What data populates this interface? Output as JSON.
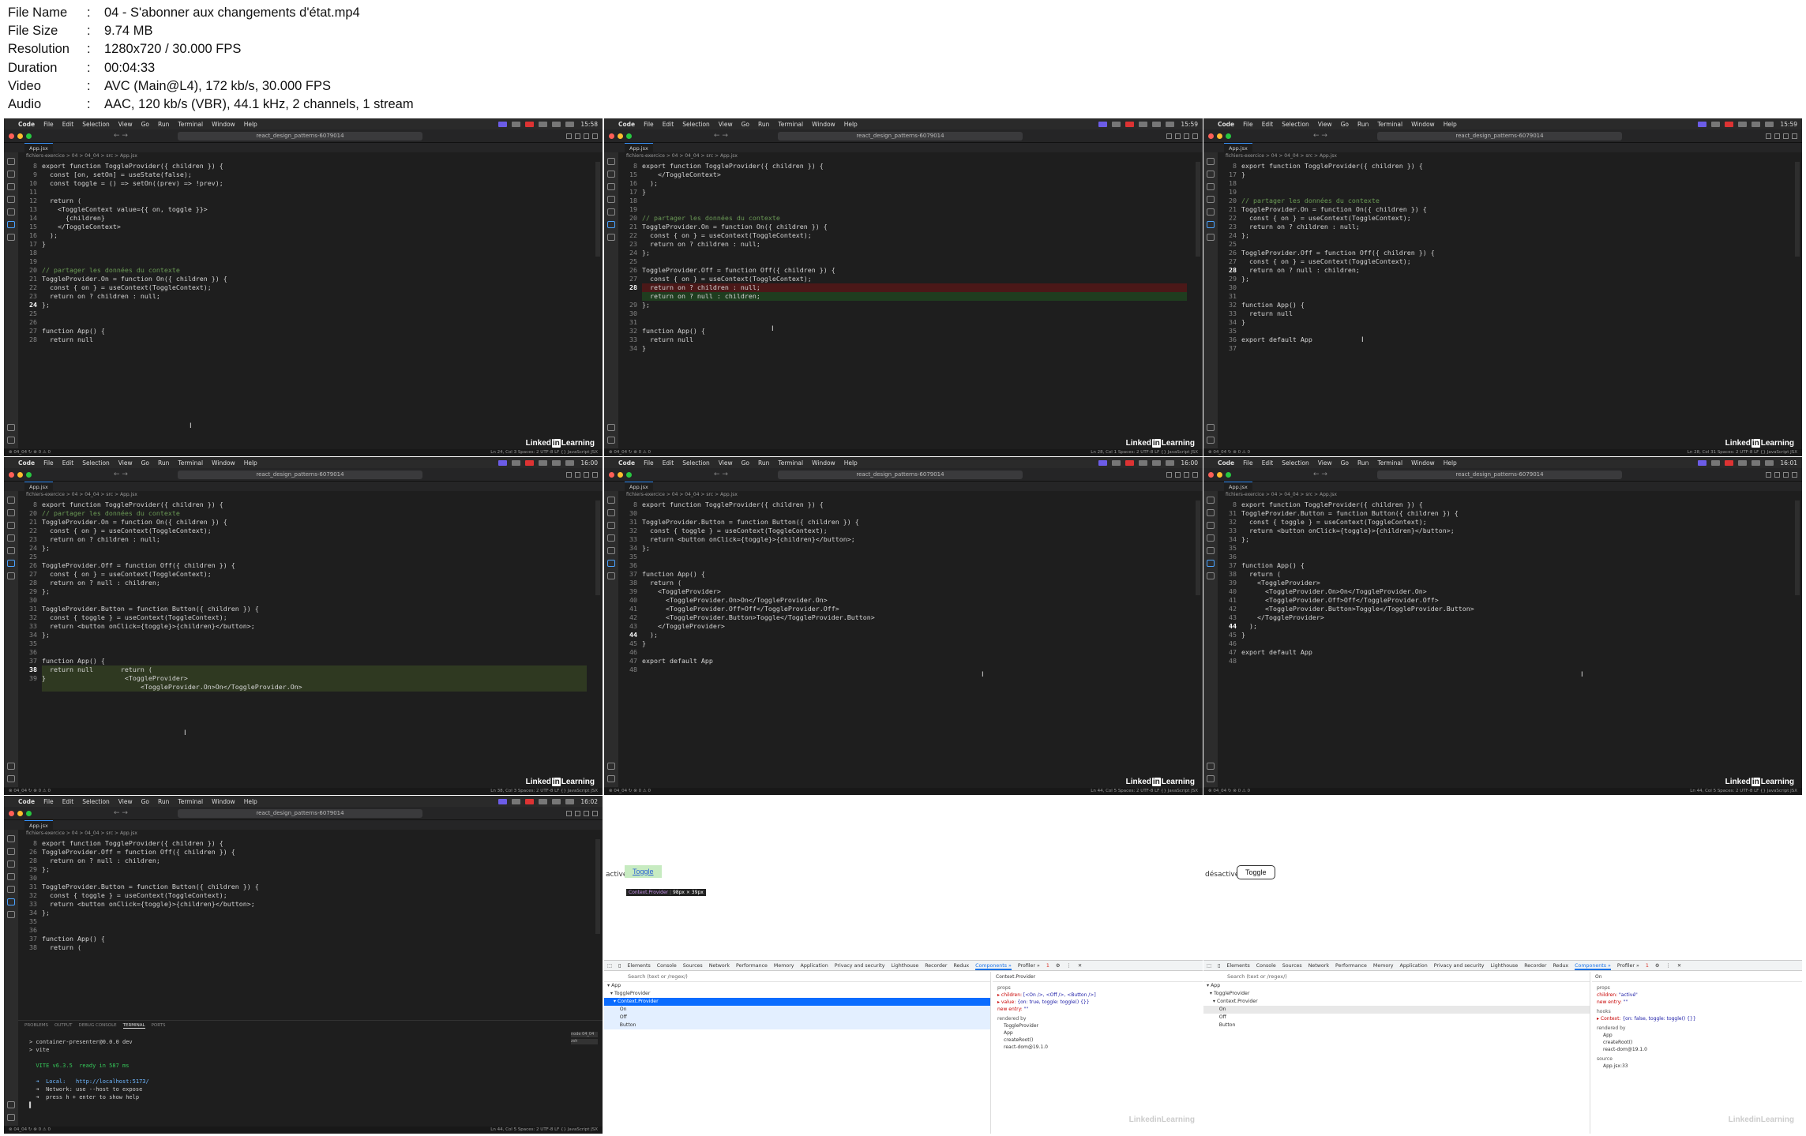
{
  "info": {
    "rows": [
      {
        "k": "File Name",
        "v": "04 - S'abonner aux changements d'état.mp4"
      },
      {
        "k": "File Size",
        "v": "9.74 MB"
      },
      {
        "k": "Resolution",
        "v": "1280x720 / 30.000 FPS"
      },
      {
        "k": "Duration",
        "v": "00:04:33"
      },
      {
        "k": "Video",
        "v": "AVC (Main@L4), 172 kb/s, 30.000 FPS"
      },
      {
        "k": "Audio",
        "v": "AAC, 120 kb/s (VBR), 44.1 kHz, 2 channels, 1 stream"
      }
    ]
  },
  "common": {
    "menu": [
      "Code",
      "File",
      "Edit",
      "Selection",
      "View",
      "Go",
      "Run",
      "Terminal",
      "Window",
      "Help"
    ],
    "search": "react_design_patterns-6079014",
    "tab": "App.jsx",
    "crumb": "fichiers-exercice > 04 > 04_04 > src > App.jsx",
    "branding_a": "Linked",
    "branding_b": "in",
    "branding_c": "Learning"
  },
  "editors": [
    {
      "clock": "15:58",
      "lines": [
        {
          "n": "8",
          "t": "export function ToggleProvider({ children }) {"
        },
        {
          "n": "9",
          "t": "  const [on, setOn] = useState(false);"
        },
        {
          "n": "10",
          "t": "  const toggle = () => setOn((prev) => !prev);"
        },
        {
          "n": "11",
          "t": ""
        },
        {
          "n": "12",
          "t": "  return ("
        },
        {
          "n": "13",
          "t": "    <ToggleContext value={{ on, toggle }}>"
        },
        {
          "n": "14",
          "t": "      {children}"
        },
        {
          "n": "15",
          "t": "    </ToggleContext>"
        },
        {
          "n": "16",
          "t": "  );"
        },
        {
          "n": "17",
          "t": "}"
        },
        {
          "n": "18",
          "t": ""
        },
        {
          "n": "19",
          "t": ""
        },
        {
          "n": "20",
          "t": "// partager les données du contexte"
        },
        {
          "n": "21",
          "t": "ToggleProvider.On = function On({ children }) {"
        },
        {
          "n": "22",
          "t": "  const { on } = useContext(ToggleContext);"
        },
        {
          "n": "23",
          "t": "  return on ? children : null;"
        },
        {
          "n": "24",
          "t": "};"
        },
        {
          "n": "25",
          "t": ""
        },
        {
          "n": "26",
          "t": ""
        },
        {
          "n": "27",
          "t": "function App() {"
        },
        {
          "n": "28",
          "t": "  return null"
        }
      ],
      "cur": "24",
      "status_left": "⊗ 04_04 ↻ ⊗ 0 ⚠ 0",
      "status_right": "Ln 24, Col 3   Spaces: 2   UTF-8   LF   {} JavaScript JSX"
    },
    {
      "clock": "15:59",
      "lines": [
        {
          "n": "8",
          "t": "export function ToggleProvider({ children }) {"
        },
        {
          "n": "15",
          "t": "    </ToggleContext>"
        },
        {
          "n": "16",
          "t": "  );"
        },
        {
          "n": "17",
          "t": "}"
        },
        {
          "n": "18",
          "t": ""
        },
        {
          "n": "19",
          "t": ""
        },
        {
          "n": "20",
          "t": "// partager les données du contexte"
        },
        {
          "n": "21",
          "t": "ToggleProvider.On = function On({ children }) {"
        },
        {
          "n": "22",
          "t": "  const { on } = useContext(ToggleContext);"
        },
        {
          "n": "23",
          "t": "  return on ? children : null;"
        },
        {
          "n": "24",
          "t": "};"
        },
        {
          "n": "25",
          "t": ""
        },
        {
          "n": "26",
          "t": "ToggleProvider.Off = function Off({ children }) {"
        },
        {
          "n": "27",
          "t": "  const { on } = useContext(ToggleContext);"
        },
        {
          "n": "28",
          "t": "  return on ? children : null;"
        },
        {
          "n": "",
          "t": "  return on ? null : children;"
        },
        {
          "n": "29",
          "t": "};"
        },
        {
          "n": "30",
          "t": ""
        },
        {
          "n": "31",
          "t": ""
        },
        {
          "n": "32",
          "t": "function App() {"
        },
        {
          "n": "33",
          "t": "  return null"
        },
        {
          "n": "34",
          "t": "}"
        }
      ],
      "cur": "28",
      "status_left": "⊗ 04_04 ↻ ⊗ 0 ⚠ 0",
      "status_right": "Ln 28, Col 1   Spaces: 2   UTF-8   LF   {} JavaScript JSX"
    },
    {
      "clock": "15:59",
      "lines": [
        {
          "n": "8",
          "t": "export function ToggleProvider({ children }) {"
        },
        {
          "n": "17",
          "t": "}"
        },
        {
          "n": "18",
          "t": ""
        },
        {
          "n": "19",
          "t": ""
        },
        {
          "n": "20",
          "t": "// partager les données du contexte"
        },
        {
          "n": "21",
          "t": "ToggleProvider.On = function On({ children }) {"
        },
        {
          "n": "22",
          "t": "  const { on } = useContext(ToggleContext);"
        },
        {
          "n": "23",
          "t": "  return on ? children : null;"
        },
        {
          "n": "24",
          "t": "};"
        },
        {
          "n": "25",
          "t": ""
        },
        {
          "n": "26",
          "t": "ToggleProvider.Off = function Off({ children }) {"
        },
        {
          "n": "27",
          "t": "  const { on } = useContext(ToggleContext);"
        },
        {
          "n": "28",
          "t": "  return on ? null : children;"
        },
        {
          "n": "29",
          "t": "};"
        },
        {
          "n": "30",
          "t": ""
        },
        {
          "n": "31",
          "t": ""
        },
        {
          "n": "32",
          "t": "function App() {"
        },
        {
          "n": "33",
          "t": "  return null"
        },
        {
          "n": "34",
          "t": "}"
        },
        {
          "n": "35",
          "t": ""
        },
        {
          "n": "36",
          "t": "export default App"
        },
        {
          "n": "37",
          "t": ""
        }
      ],
      "cur": "28",
      "status_left": "⊗ 04_04 ↻ ⊗ 0 ⚠ 0",
      "status_right": "Ln 28, Col 31   Spaces: 2   UTF-8   LF   {} JavaScript JSX"
    },
    {
      "clock": "16:00",
      "lines": [
        {
          "n": "8",
          "t": "export function ToggleProvider({ children }) {"
        },
        {
          "n": "20",
          "t": "// partager les données du contexte"
        },
        {
          "n": "21",
          "t": "ToggleProvider.On = function On({ children }) {"
        },
        {
          "n": "22",
          "t": "  const { on } = useContext(ToggleContext);"
        },
        {
          "n": "23",
          "t": "  return on ? children : null;"
        },
        {
          "n": "24",
          "t": "};"
        },
        {
          "n": "25",
          "t": ""
        },
        {
          "n": "26",
          "t": "ToggleProvider.Off = function Off({ children }) {"
        },
        {
          "n": "27",
          "t": "  const { on } = useContext(ToggleContext);"
        },
        {
          "n": "28",
          "t": "  return on ? null : children;"
        },
        {
          "n": "29",
          "t": "};"
        },
        {
          "n": "30",
          "t": ""
        },
        {
          "n": "31",
          "t": "ToggleProvider.Button = function Button({ children }) {"
        },
        {
          "n": "32",
          "t": "  const { toggle } = useContext(ToggleContext);"
        },
        {
          "n": "33",
          "t": "  return <button onClick={toggle}>{children}</button>;"
        },
        {
          "n": "34",
          "t": "};"
        },
        {
          "n": "35",
          "t": ""
        },
        {
          "n": "36",
          "t": ""
        },
        {
          "n": "37",
          "t": "function App() {"
        },
        {
          "n": "38",
          "t": "  return null       return ("
        },
        {
          "n": "39",
          "t": "}                    <ToggleProvider>"
        },
        {
          "n": "",
          "t": "                         <ToggleProvider.On>On</ToggleProvider.On>"
        }
      ],
      "cur": "38",
      "status_left": "⊗ 04_04 ↻ ⊗ 0 ⚠ 0",
      "status_right": "Ln 38, Col 3   Spaces: 2   UTF-8   LF   {} JavaScript JSX"
    },
    {
      "clock": "16:00",
      "lines": [
        {
          "n": "8",
          "t": "export function ToggleProvider({ children }) {"
        },
        {
          "n": "30",
          "t": ""
        },
        {
          "n": "31",
          "t": "ToggleProvider.Button = function Button({ children }) {"
        },
        {
          "n": "32",
          "t": "  const { toggle } = useContext(ToggleContext);"
        },
        {
          "n": "33",
          "t": "  return <button onClick={toggle}>{children}</button>;"
        },
        {
          "n": "34",
          "t": "};"
        },
        {
          "n": "35",
          "t": ""
        },
        {
          "n": "36",
          "t": ""
        },
        {
          "n": "37",
          "t": "function App() {"
        },
        {
          "n": "38",
          "t": "  return ("
        },
        {
          "n": "39",
          "t": "    <ToggleProvider>"
        },
        {
          "n": "40",
          "t": "      <ToggleProvider.On>On</ToggleProvider.On>"
        },
        {
          "n": "41",
          "t": "      <ToggleProvider.Off>Off</ToggleProvider.Off>"
        },
        {
          "n": "42",
          "t": "      <ToggleProvider.Button>Toggle</ToggleProvider.Button>"
        },
        {
          "n": "43",
          "t": "    </ToggleProvider>"
        },
        {
          "n": "44",
          "t": "  );"
        },
        {
          "n": "45",
          "t": "}"
        },
        {
          "n": "46",
          "t": ""
        },
        {
          "n": "47",
          "t": "export default App"
        },
        {
          "n": "48",
          "t": ""
        }
      ],
      "cur": "44",
      "status_left": "⊗ 04_04 ↻ ⊗ 0 ⚠ 0",
      "status_right": "Ln 44, Col 5   Spaces: 2   UTF-8   LF   {} JavaScript JSX"
    },
    {
      "clock": "16:01",
      "lines": [
        {
          "n": "8",
          "t": "export function ToggleProvider({ children }) {"
        },
        {
          "n": "31",
          "t": "ToggleProvider.Button = function Button({ children }) {"
        },
        {
          "n": "32",
          "t": "  const { toggle } = useContext(ToggleContext);"
        },
        {
          "n": "33",
          "t": "  return <button onClick={toggle}>{children}</button>;"
        },
        {
          "n": "34",
          "t": "};"
        },
        {
          "n": "35",
          "t": ""
        },
        {
          "n": "36",
          "t": ""
        },
        {
          "n": "37",
          "t": "function App() {"
        },
        {
          "n": "38",
          "t": "  return ("
        },
        {
          "n": "39",
          "t": "    <ToggleProvider>"
        },
        {
          "n": "40",
          "t": "      <ToggleProvider.On>On</ToggleProvider.On>"
        },
        {
          "n": "41",
          "t": "      <ToggleProvider.Off>Off</ToggleProvider.Off>"
        },
        {
          "n": "42",
          "t": "      <ToggleProvider.Button>Toggle</ToggleProvider.Button>"
        },
        {
          "n": "43",
          "t": "    </ToggleProvider>"
        },
        {
          "n": "44",
          "t": "  );"
        },
        {
          "n": "45",
          "t": "}"
        },
        {
          "n": "46",
          "t": ""
        },
        {
          "n": "47",
          "t": "export default App"
        },
        {
          "n": "48",
          "t": ""
        }
      ],
      "cur": "44",
      "status_left": "⊗ 04_04 ↻ ⊗ 0 ⚠ 0",
      "status_right": "Ln 44, Col 5   Spaces: 2   UTF-8   LF   {} JavaScript JSX"
    },
    {
      "clock": "16:02",
      "lines": [
        {
          "n": "8",
          "t": "export function ToggleProvider({ children }) {"
        },
        {
          "n": "26",
          "t": "ToggleProvider.Off = function Off({ children }) {"
        },
        {
          "n": "28",
          "t": "  return on ? null : children;"
        },
        {
          "n": "29",
          "t": "};"
        },
        {
          "n": "30",
          "t": ""
        },
        {
          "n": "31",
          "t": "ToggleProvider.Button = function Button({ children }) {"
        },
        {
          "n": "32",
          "t": "  const { toggle } = useContext(ToggleContext);"
        },
        {
          "n": "33",
          "t": "  return <button onClick={toggle}>{children}</button>;"
        },
        {
          "n": "34",
          "t": "};"
        },
        {
          "n": "35",
          "t": ""
        },
        {
          "n": "36",
          "t": ""
        },
        {
          "n": "37",
          "t": "function App() {"
        },
        {
          "n": "38",
          "t": "  return ("
        }
      ],
      "cur": "",
      "status_left": "⊗ 04_04 ↻ ⊗ 0 ⚠ 0",
      "status_right": "Ln 44, Col 5   Spaces: 2   UTF-8   LF   {} JavaScript JSX"
    }
  ],
  "terminal": {
    "tabs": [
      "PROBLEMS",
      "OUTPUT",
      "DEBUG CONSOLE",
      "TERMINAL",
      "PORTS"
    ],
    "selected": "TERMINAL",
    "badges": [
      "node 04_04",
      "zsh"
    ],
    "lines": [
      "",
      "> container-presenter@0.0.0 dev",
      "> vite",
      "",
      "  VITE v6.3.5  ready in 587 ms",
      "",
      "  ➜  Local:   http://localhost:5173/",
      "  ➜  Network: use --host to expose",
      "  ➜  press h + enter to show help"
    ]
  },
  "browser1": {
    "state_text": "activé",
    "button": "Toggle",
    "tooltip_name": "Context.Provider",
    "tooltip_size": "98px × 39px",
    "tabs": [
      "Elements",
      "Console",
      "Sources",
      "Network",
      "Performance",
      "Memory",
      "Application",
      "Privacy and security",
      "Lighthouse",
      "Recorder",
      "Redux",
      "Components »",
      "Profiler »"
    ],
    "selected_tab": "Components »",
    "errors": "1",
    "search_placeholder": "Search (text or /regex/)",
    "tree": [
      {
        "label": "▾ App",
        "state": ""
      },
      {
        "label": "  ▾ ToggleProvider",
        "state": ""
      },
      {
        "label": "    ▾ Context.Provider",
        "state": "sel"
      },
      {
        "label": "        On",
        "state": "light"
      },
      {
        "label": "        Off",
        "state": "light"
      },
      {
        "label": "        Button",
        "state": "light"
      }
    ],
    "panel_title": "Context.Provider",
    "props_heading": "props",
    "props": [
      {
        "k": "▸ children:",
        "v": " [<On />, <Off />, <Button />]"
      },
      {
        "k": "▸ value:",
        "v": " {on: true, toggle: toggle() {}}"
      },
      {
        "k": "  new entry:",
        "v": " \"\""
      }
    ],
    "rendered_heading": "rendered by",
    "rendered": [
      "ToggleProvider",
      "App",
      "createRoot()",
      "react-dom@19.1.0"
    ]
  },
  "browser2": {
    "state_text": "désactivé",
    "button": "Toggle",
    "tabs": [
      "Elements",
      "Console",
      "Sources",
      "Network",
      "Performance",
      "Memory",
      "Application",
      "Privacy and security",
      "Lighthouse",
      "Recorder",
      "Redux",
      "Components »",
      "Profiler »"
    ],
    "selected_tab": "Components »",
    "errors": "1",
    "search_placeholder": "Search (text or /regex/)",
    "tree": [
      {
        "label": "▾ App",
        "state": ""
      },
      {
        "label": "  ▾ ToggleProvider",
        "state": ""
      },
      {
        "label": "    ▾ Context.Provider",
        "state": ""
      },
      {
        "label": "        On",
        "state": "grey"
      },
      {
        "label": "        Off",
        "state": ""
      },
      {
        "label": "        Button",
        "state": ""
      }
    ],
    "panel_title": "On",
    "props_heading": "props",
    "props": [
      {
        "k": "  children:",
        "v": " \"activé\""
      },
      {
        "k": "  new entry:",
        "v": " \"\""
      }
    ],
    "hooks_heading": "hooks",
    "hooks": [
      {
        "k": "▸ Context:",
        "v": " {on: false, toggle: toggle() {}}"
      }
    ],
    "rendered_heading": "rendered by",
    "rendered": [
      "App",
      "createRoot()",
      "react-dom@19.1.0"
    ],
    "source_heading": "source",
    "source": "App.jsx:33"
  }
}
